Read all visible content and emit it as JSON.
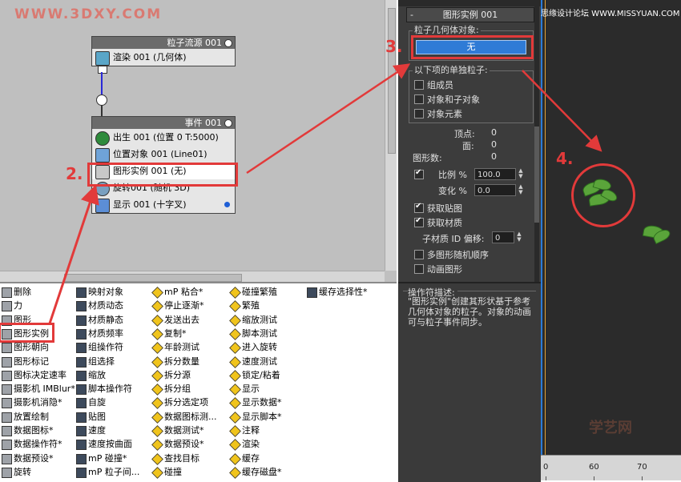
{
  "watermark": "WWW.3DXY.COM",
  "graph": {
    "source_node": {
      "title": "粒子流源 001",
      "rows": [
        "渲染 001 (几何体)"
      ]
    },
    "event_node": {
      "title": "事件 001",
      "rows": [
        "出生 001 (位置 0 T:5000)",
        "位置对象 001 (Line01)",
        "图形实例 001 (无)",
        "旋转001 (随机 3D)",
        "显示 001 (十字叉)"
      ]
    }
  },
  "annotations": {
    "step2": "2.",
    "step3": "3.",
    "step4": "4."
  },
  "depot": {
    "col1": [
      "删除",
      "力",
      "图形",
      "图形实例",
      "图形朝向",
      "图形标记",
      "图标决定速率",
      "摄影机 IMBlur*",
      "摄影机消隐*",
      "放置绘制",
      "数据图标*",
      "数据操作符*",
      "数据预设*",
      "旋转"
    ],
    "col2": [
      "映射对象",
      "材质动态",
      "材质静态",
      "材质频率",
      "组操作符",
      "组选择",
      "缩放",
      "脚本操作符",
      "自旋",
      "贴图",
      "速度",
      "速度按曲面",
      "mP 碰撞*",
      "mP 粒子间..."
    ],
    "col3": [
      "mP 粘合*",
      "停止逐渐*",
      "发送出去",
      "复制*",
      "年龄测试",
      "拆分数量",
      "拆分源",
      "拆分组",
      "拆分选定项",
      "数据图标测...",
      "数据测试*",
      "数据预设*",
      "查找目标",
      "碰撞"
    ],
    "col4": [
      "碰撞繁殖",
      "繁殖",
      "缩放测试",
      "脚本测试",
      "进入旋转",
      "速度测试",
      "锁定/粘着",
      "显示",
      "显示数据*",
      "显示脚本*",
      "注释",
      "渲染",
      "缓存",
      "缓存磁盘*"
    ],
    "col5": [
      "缓存选择性*"
    ]
  },
  "params": {
    "rollout_minus": "-",
    "rollout_title": "图形实例 001",
    "geometry_group_title": "粒子几何体对象:",
    "none_button": "无",
    "separate_group_title": "以下项的单独粒子:",
    "separate_options": [
      {
        "label": "组成员",
        "checked": false
      },
      {
        "label": "对象和子对象",
        "checked": false
      },
      {
        "label": "对象元素",
        "checked": false
      }
    ],
    "vertices_label": "顶点:",
    "vertices_value": "0",
    "faces_label": "面:",
    "faces_value": "0",
    "shape_count_label": "图形数:",
    "shape_count_value": "0",
    "scale_label": "比例 %",
    "scale_value": "100.0",
    "variation_label": "变化 %",
    "variation_value": "0.0",
    "acquire_map": "获取贴图",
    "acquire_material": "获取材质",
    "submat_offset_label": "子材质 ID 偏移:",
    "submat_offset_value": "0",
    "multi_shape_random": "多图形随机顺序",
    "animated_shape": "动画图形"
  },
  "description": {
    "title": "操作符描述:",
    "text": "\"图形实例\"创建其形状基于参考几何体对象的粒子。对象的动画可与粒子事件同步。"
  },
  "viewport": {
    "forum_text": "思缘设计论坛 WWW.MISSYUAN.COM",
    "ruler_numbers": [
      "0",
      "60",
      "70"
    ],
    "logo_text": "学艺网"
  },
  "colors": {
    "annotation_red": "#e23a3a",
    "selected_blue": "#2f7bd6"
  }
}
